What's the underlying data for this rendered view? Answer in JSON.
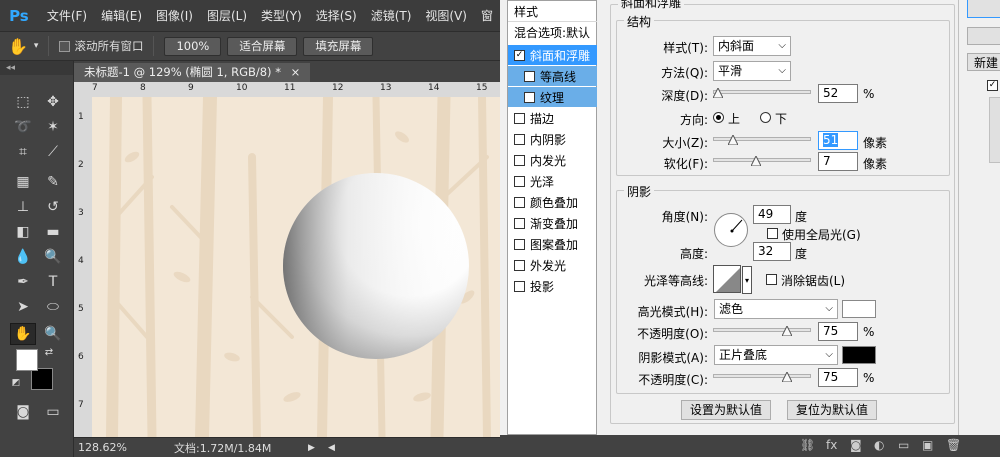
{
  "app": {
    "logo": "Ps",
    "menu": [
      "文件(F)",
      "编辑(E)",
      "图像(I)",
      "图层(L)",
      "类型(Y)",
      "选择(S)",
      "滤镜(T)",
      "视图(V)",
      "窗"
    ]
  },
  "options_bar": {
    "scroll_all_label": "滚动所有窗口",
    "zoom_100": "100%",
    "fit_screen": "适合屏幕",
    "fill_screen": "填充屏幕"
  },
  "document": {
    "tab_title": "未标题-1 @ 129% (椭圆 1, RGB/8) *",
    "ruler_marks": [
      "7",
      "8",
      "9",
      "10",
      "11",
      "12",
      "13",
      "14",
      "15"
    ],
    "ruler_left_marks": [
      "1",
      "2",
      "3",
      "4",
      "5",
      "6",
      "7"
    ],
    "zoom": "128.62%",
    "doc_info": "文档:1.72M/1.84M"
  },
  "toolbar": {
    "collapse": "◂◂"
  },
  "layer_style": {
    "list": [
      {
        "label": "样式",
        "checkbox": false,
        "checked": false,
        "state": "header"
      },
      {
        "label": "混合选项:默认",
        "checkbox": false,
        "checked": false,
        "state": "header"
      },
      {
        "label": "斜面和浮雕",
        "checkbox": true,
        "checked": true,
        "state": "selected"
      },
      {
        "label": "等高线",
        "checkbox": true,
        "checked": false,
        "state": "sub"
      },
      {
        "label": "纹理",
        "checkbox": true,
        "checked": false,
        "state": "sub"
      },
      {
        "label": "描边",
        "checkbox": true,
        "checked": false,
        "state": "normal"
      },
      {
        "label": "内阴影",
        "checkbox": true,
        "checked": false,
        "state": "normal"
      },
      {
        "label": "内发光",
        "checkbox": true,
        "checked": false,
        "state": "normal"
      },
      {
        "label": "光泽",
        "checkbox": true,
        "checked": false,
        "state": "normal"
      },
      {
        "label": "颜色叠加",
        "checkbox": true,
        "checked": false,
        "state": "normal"
      },
      {
        "label": "渐变叠加",
        "checkbox": true,
        "checked": false,
        "state": "normal"
      },
      {
        "label": "图案叠加",
        "checkbox": true,
        "checked": false,
        "state": "normal"
      },
      {
        "label": "外发光",
        "checkbox": true,
        "checked": false,
        "state": "normal"
      },
      {
        "label": "投影",
        "checkbox": true,
        "checked": false,
        "state": "normal"
      }
    ],
    "section_title": "斜面和浮雕",
    "structure": {
      "title": "结构",
      "style_label": "样式(T):",
      "style_value": "内斜面",
      "technique_label": "方法(Q):",
      "technique_value": "平滑",
      "depth_label": "深度(D):",
      "depth_value": "52",
      "depth_unit": "%",
      "depth_fraction": 0.052,
      "direction_label": "方向:",
      "direction_up": "上",
      "direction_down": "下",
      "size_label": "大小(Z):",
      "size_value": "51",
      "size_unit": "像素",
      "size_fraction": 0.204,
      "soften_label": "软化(F):",
      "soften_value": "7",
      "soften_unit": "像素",
      "soften_fraction": 0.4375
    },
    "shading": {
      "title": "阴影",
      "angle_label": "角度(N):",
      "angle_value": "49",
      "angle_unit": "度",
      "global_light_label": "使用全局光(G)",
      "altitude_label": "高度:",
      "altitude_value": "32",
      "altitude_unit": "度",
      "gloss_contour_label": "光泽等高线:",
      "antialias_label": "消除锯齿(L)",
      "highlight_mode_label": "高光模式(H):",
      "highlight_mode_value": "滤色",
      "highlight_color": "#ffffff",
      "highlight_opacity_label": "不透明度(O):",
      "highlight_opacity_value": "75",
      "highlight_opacity_unit": "%",
      "highlight_opacity_fraction": 0.75,
      "shadow_mode_label": "阴影模式(A):",
      "shadow_mode_value": "正片叠底",
      "shadow_color": "#000000",
      "shadow_opacity_label": "不透明度(C):",
      "shadow_opacity_value": "75",
      "shadow_opacity_unit": "%",
      "shadow_opacity_fraction": 0.75
    },
    "buttons": {
      "make_default": "设置为默认值",
      "reset_default": "复位为默认值"
    },
    "right": {
      "new_style": "新建"
    }
  }
}
